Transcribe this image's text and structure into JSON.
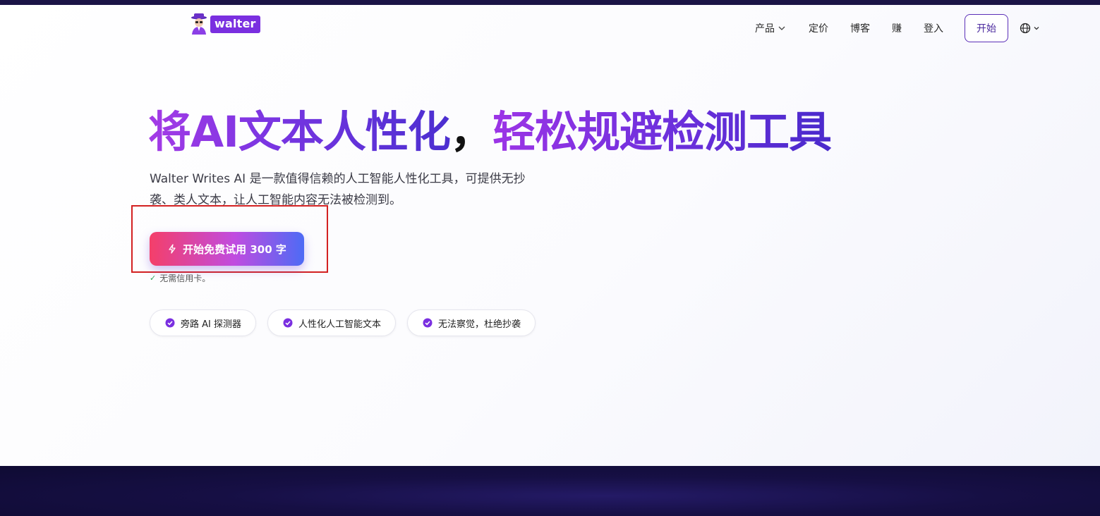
{
  "header": {
    "logo_text": "walter",
    "nav": {
      "products": "产品",
      "pricing": "定价",
      "blog": "博客",
      "earn": "赚",
      "login": "登入"
    },
    "start_label": "开始"
  },
  "hero": {
    "title_part1": "将AI文本人性化",
    "title_comma": "，",
    "title_part2": "轻松规避检测工具",
    "description": "Walter Writes AI 是一款值得信赖的人工智能人性化工具，可提供无抄袭、类人文本，让人工智能内容无法被检测到。",
    "cta_label": "开始免费试用 300 字",
    "no_card": "无需信用卡。"
  },
  "features": [
    {
      "label": "旁路 AI 探测器"
    },
    {
      "label": "人性化人工智能文本"
    },
    {
      "label": "无法察觉，杜绝抄袭"
    }
  ],
  "colors": {
    "accent": "#7a2fe0",
    "cta_start": "#f43f6a",
    "cta_end": "#4d6bf5",
    "highlight_box": "#d32121",
    "footer_band": "#160f44"
  }
}
